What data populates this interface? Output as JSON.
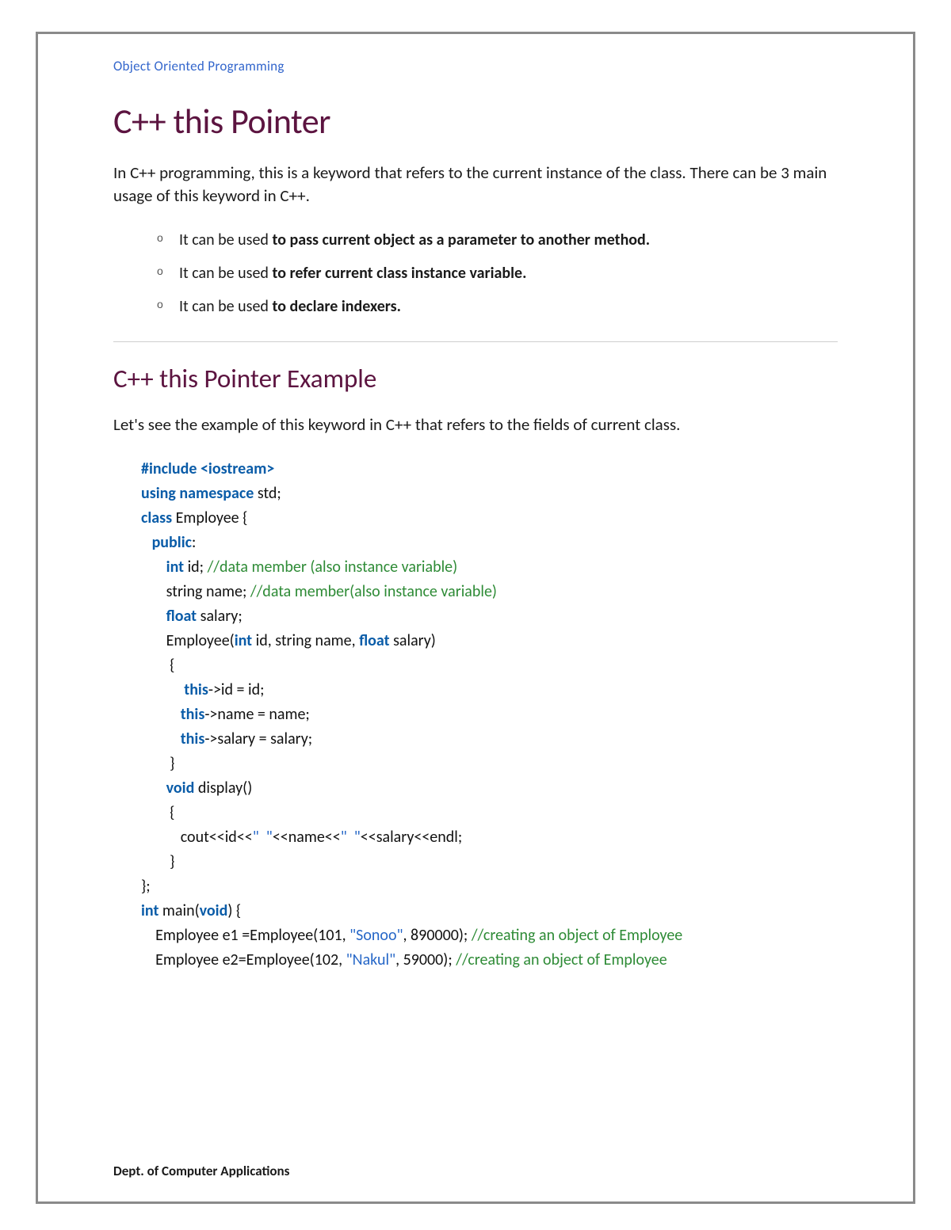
{
  "header": {
    "course_link": "Object Oriented Programming"
  },
  "article": {
    "title": "C++ this Pointer",
    "intro": "In C++ programming, this is a keyword that refers to the current instance of the class. There can be 3 main usage of this keyword in C++.",
    "usages": [
      {
        "prefix": "It can be used ",
        "bold": "to pass current object as a parameter to another method."
      },
      {
        "prefix": "It can be used ",
        "bold": "to refer current class instance variable."
      },
      {
        "prefix": "It can be used ",
        "bold": "to declare indexers."
      }
    ],
    "subtitle": "C++ this Pointer Example",
    "lead": "Let's see the example of this keyword in C++ that refers to the fields of current class.",
    "code": {
      "l1": "#include <iostream>",
      "l2a": "using namespace",
      "l2b": " std;",
      "l3a": "class",
      "l3b": " Employee {",
      "l4": "   public",
      "l4b": ":",
      "l5a": "       int",
      "l5b": " id; ",
      "l5c": "//data member (also instance variable)",
      "l6a": "       string name; ",
      "l6b": "//data member(also instance variable)",
      "l7a": "       float",
      "l7b": " salary;",
      "l8a": "       Employee(",
      "l8b": "int",
      "l8c": " id, string name, ",
      "l8d": "float",
      "l8e": " salary)",
      "l9": "        {",
      "l10a": "            this",
      "l10b": "->id = id;",
      "l11a": "           this",
      "l11b": "->name = name;",
      "l12a": "           this",
      "l12b": "->salary = salary;",
      "l13": "        }",
      "l14a": "       void",
      "l14b": " display()",
      "l15": "        {",
      "l16a": "           cout<<id<<",
      "l16b": "\"  \"",
      "l16c": "<<name<<",
      "l16d": "\"  \"",
      "l16e": "<<salary<<endl;",
      "l17": "        }",
      "l18": "};",
      "l19a": "int",
      "l19b": " main(",
      "l19c": "void",
      "l19d": ") {",
      "l20a": "    Employee e1 =Employee(101, ",
      "l20b": "\"Sonoo\"",
      "l20c": ", 890000); ",
      "l20d": "//creating an object of Employee",
      "l21a": "    Employee e2=Employee(102, ",
      "l21b": "\"Nakul\"",
      "l21c": ", 59000); ",
      "l21d": "//creating an object of Employee"
    }
  },
  "footer": {
    "dept": "Dept. of Computer Applications"
  }
}
